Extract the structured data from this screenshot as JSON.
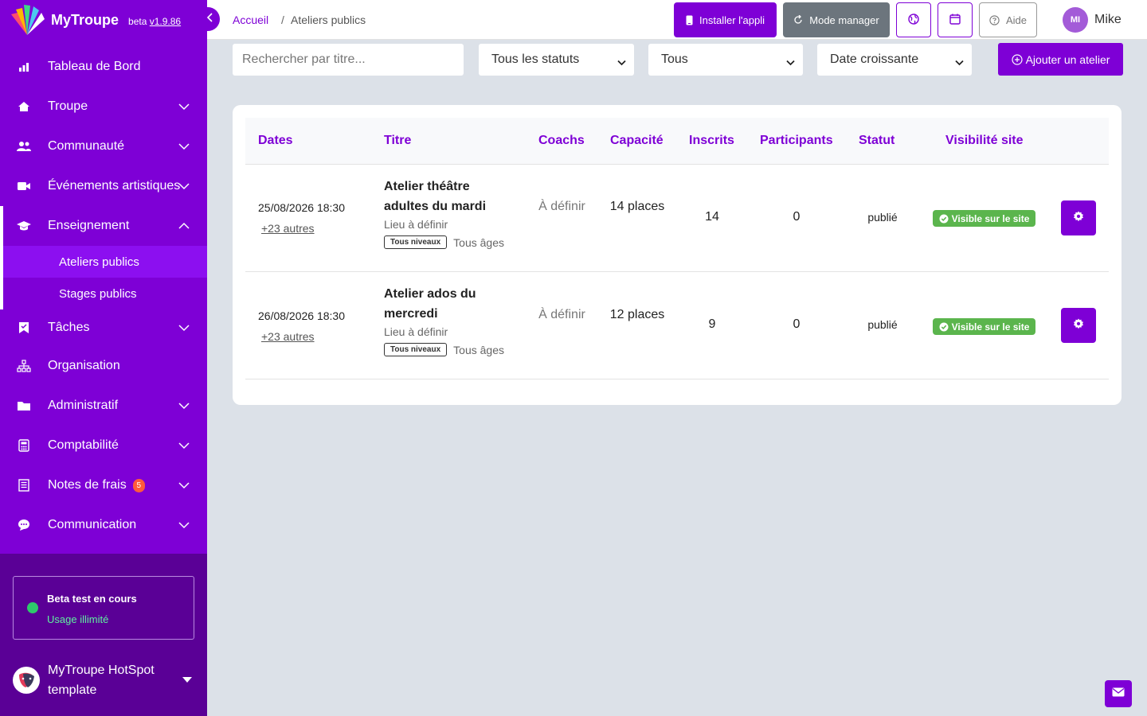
{
  "brand": {
    "name": "MyTroupe",
    "beta": "beta",
    "version": "v1.9.86"
  },
  "sidebar": {
    "items": [
      {
        "label": "Tableau de Bord",
        "icon": "chart-bar-icon"
      },
      {
        "label": "Troupe",
        "icon": "home-icon"
      },
      {
        "label": "Communauté",
        "icon": "users-icon"
      },
      {
        "label": "Événements artistiques",
        "icon": "video-icon"
      },
      {
        "label": "Enseignement",
        "icon": "graduation-cap-icon"
      },
      {
        "label": "Tâches",
        "icon": "bookmark-check-icon"
      },
      {
        "label": "Organisation",
        "icon": "sitemap-icon"
      },
      {
        "label": "Administratif",
        "icon": "folder-icon"
      },
      {
        "label": "Comptabilité",
        "icon": "calculator-icon"
      },
      {
        "label": "Notes de frais",
        "icon": "receipt-icon",
        "badge": "5"
      },
      {
        "label": "Communication",
        "icon": "chat-icon"
      }
    ],
    "subitems": [
      {
        "label": "Ateliers publics"
      },
      {
        "label": "Stages publics"
      }
    ],
    "beta_box": {
      "title": "Beta test en cours",
      "subtitle": "Usage illimité"
    },
    "org": {
      "name": "MyTroupe HotSpot template"
    }
  },
  "topbar": {
    "breadcrumb_home": "Accueil",
    "breadcrumb_sep": "/",
    "breadcrumb_current": "Ateliers publics",
    "install_label": "Installer l'appli",
    "manager_label": "Mode manager",
    "help_label": "Aide",
    "user_initials": "MI",
    "user_name": "Mike"
  },
  "filters": {
    "search_placeholder": "Rechercher par titre...",
    "status": "Tous les statuts",
    "level": "Tous",
    "sort": "Date croissante",
    "add_label": "Ajouter un atelier"
  },
  "table": {
    "headers": [
      "Dates",
      "Titre",
      "Coachs",
      "Capacité",
      "Inscrits",
      "Participants",
      "Statut",
      "Visibilité site"
    ],
    "rows": [
      {
        "date": "25/08/2026 18:30",
        "more": "+23 autres",
        "title": "Atelier théâtre adultes du mardi",
        "location": "Lieu à définir",
        "level": "Tous niveaux",
        "ages": "Tous âges",
        "coachs": "À définir",
        "capacity": "14 places",
        "inscrits": "14",
        "participants": "0",
        "status": "publié",
        "visibility": "Visible sur le site"
      },
      {
        "date": "26/08/2026 18:30",
        "more": "+23 autres",
        "title": "Atelier ados du mercredi",
        "location": "Lieu à définir",
        "level": "Tous niveaux",
        "ages": "Tous âges",
        "coachs": "À définir",
        "capacity": "12 places",
        "inscrits": "9",
        "participants": "0",
        "status": "publié",
        "visibility": "Visible sur le site"
      }
    ]
  },
  "colors": {
    "accent": "#7e00d6",
    "sidebar_dark": "#5a0096",
    "success": "#5bb54d",
    "background": "#dce1e8"
  }
}
